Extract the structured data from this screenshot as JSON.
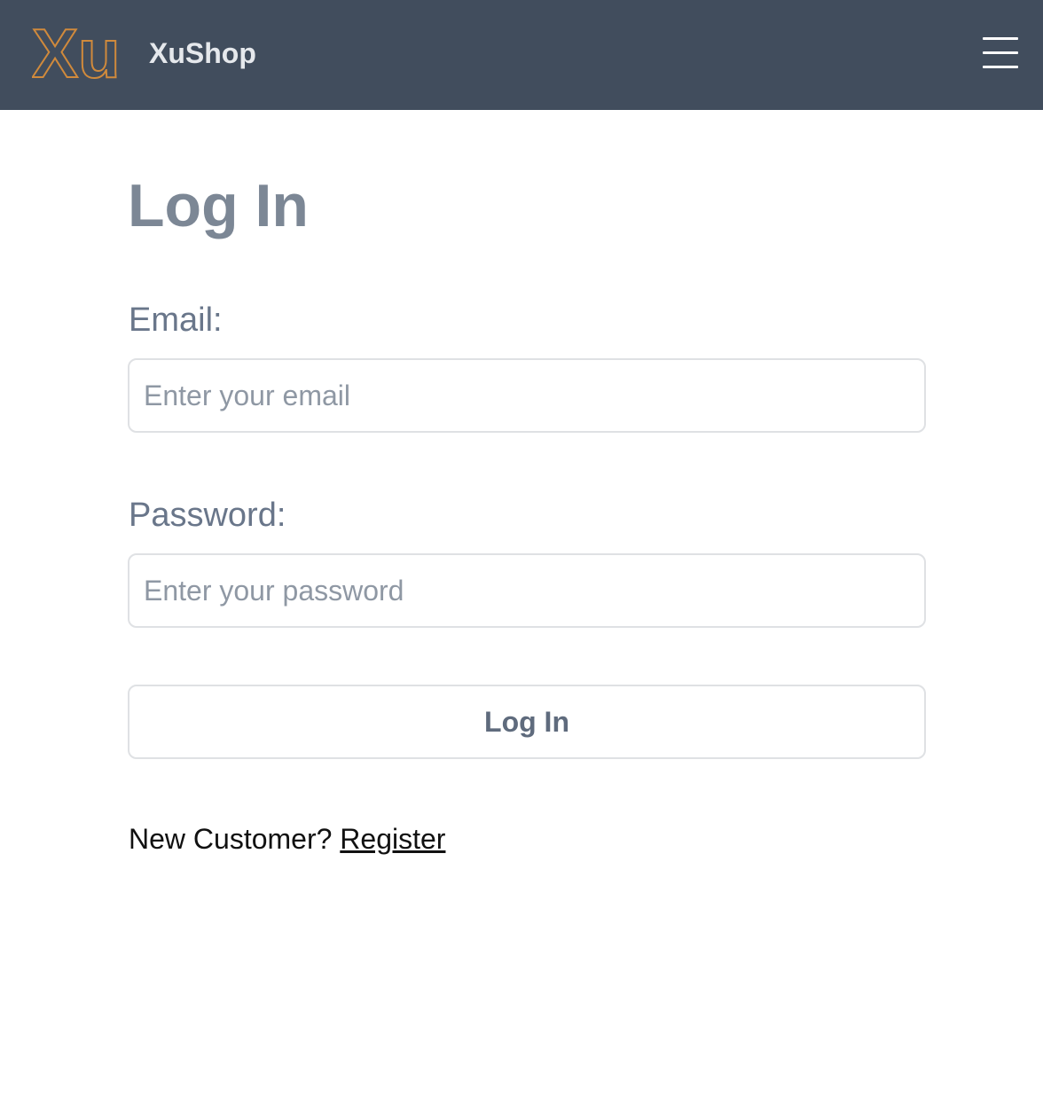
{
  "header": {
    "logo_text": "Xu",
    "brand_name": "XuShop",
    "menu_icon": "hamburger-menu-icon",
    "logo_color": "#d08a3c",
    "background_color": "#414d5d"
  },
  "login_form": {
    "title": "Log In",
    "email": {
      "label": "Email:",
      "placeholder": "Enter your email",
      "value": ""
    },
    "password": {
      "label": "Password:",
      "placeholder": "Enter your password",
      "value": ""
    },
    "submit_label": "Log In",
    "register_prompt": "New Customer?",
    "register_link": "Register"
  }
}
